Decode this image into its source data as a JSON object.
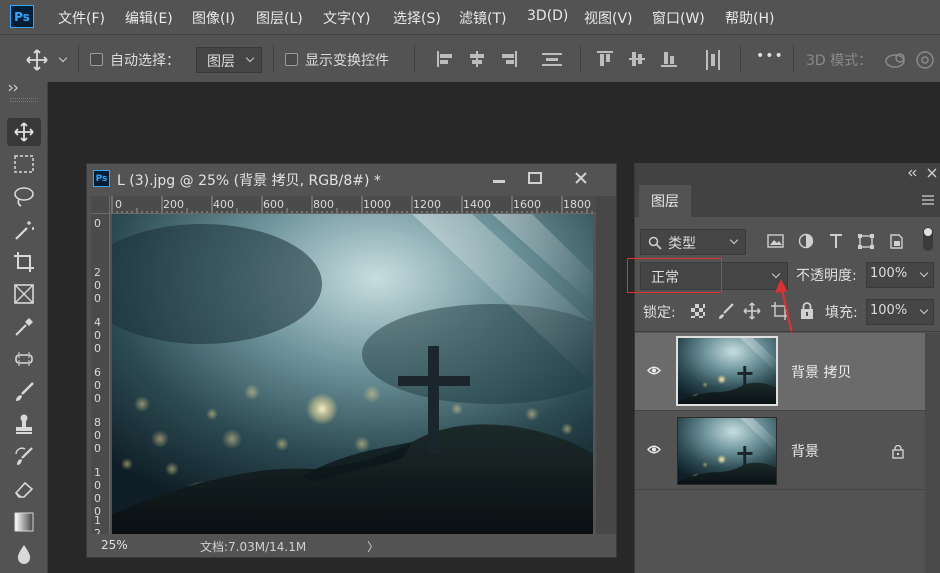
{
  "app": {
    "logo_text": "Ps"
  },
  "menu": [
    "文件(F)",
    "编辑(E)",
    "图像(I)",
    "图层(L)",
    "文字(Y)",
    "选择(S)",
    "滤镜(T)",
    "3D(D)",
    "视图(V)",
    "窗口(W)",
    "帮助(H)"
  ],
  "options": {
    "auto_select_label": "自动选择：",
    "auto_select_target": "图层",
    "show_transform_label": "显示变换控件",
    "more_label": "•••",
    "mode_3d_label": "3D 模式："
  },
  "document": {
    "title": "L (3).jpg @ 25% (背景 拷贝, RGB/8#) *",
    "zoom": "25%",
    "doc_info": "文档:7.03M/14.1M",
    "status_arrow": "〉",
    "ruler_h": [
      "0",
      "200",
      "400",
      "600",
      "800",
      "1000",
      "1200",
      "1400",
      "1600",
      "1800"
    ],
    "ruler_v": [
      "0",
      "2\n0\n0",
      "4\n0\n0",
      "6\n0\n0",
      "8\n0\n0",
      "1\n0\n0\n0",
      "1\n2"
    ]
  },
  "layers_panel": {
    "tab": "图层",
    "filter_kind": "类型",
    "blend_mode": "正常",
    "opacity_label": "不透明度:",
    "opacity_value": "100%",
    "lock_label": "锁定:",
    "fill_label": "填充:",
    "fill_value": "100%",
    "layers": [
      {
        "name": "背景 拷贝",
        "selected": true,
        "visible": true,
        "locked": false
      },
      {
        "name": "背景",
        "selected": false,
        "visible": true,
        "locked": true
      }
    ]
  },
  "colors": {
    "highlight_annotation": "#e03030",
    "ps_blue": "#31a8ff"
  }
}
